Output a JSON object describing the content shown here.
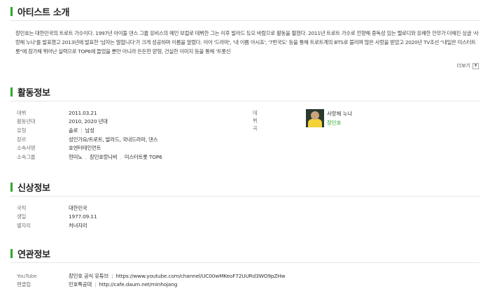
{
  "intro": {
    "heading": "아티스트 소개",
    "text": "장민호는 대한민국의 트로트 가수이다. 1997년 아이돌 댄스 그룹 유비스의 메인 보컬로 데뷔한 그는 이후 발라드 듀오 바람으로 활동을 펼쳤다. 2011년 트로트 가수로 전향해 중독성 있는 멜로디와 유쾌한 안무가 더해진 싱글 '사랑해 누나'를 발표했고 2013년에 발표한 '남자는 말합니다'가 크게 성공하며 이름을 알렸다. 이어 '드라마', '내 이름 아시죠', '7번국도' 등을 통해 트로트계의 BTS로 불리며 많은 사랑을 받았고 2020년 TV조선 \"내일은 미스터트롯\"에 참가해 뛰어난 실력으로 TOP6에 들었을 뿐만 아니라 든든한 맏형, 건실한 이미지 등을 통해 '트롯신",
    "more_label": "더보기"
  },
  "activity": {
    "heading": "활동정보",
    "rows": [
      {
        "key": "데뷔",
        "value": "2011.03.21"
      },
      {
        "key": "활동년대",
        "value": "2010, 2020 년대"
      },
      {
        "key": "유형",
        "values": [
          "솔로",
          "남성"
        ]
      },
      {
        "key": "장르",
        "value": "성인가요/트로트, 발라드, 국내드라마, 댄스"
      },
      {
        "key": "소속사명",
        "value": "호엔터테인먼트"
      },
      {
        "key": "소속그룹",
        "values": [
          "현미노",
          "장민호랑나비",
          "미스터트롯 TOP6"
        ]
      }
    ],
    "debut_song": {
      "key": "데뷔곡",
      "title": "사랑해 누나",
      "artist": "장민호"
    }
  },
  "profile": {
    "heading": "신상정보",
    "rows": [
      {
        "key": "국적",
        "value": "대한민국"
      },
      {
        "key": "생일",
        "value": "1977.09.11"
      },
      {
        "key": "별자리",
        "value": "처녀자리"
      }
    ]
  },
  "related": {
    "heading": "연관정보",
    "rows": [
      {
        "key": "YouTube",
        "name": "장민호 공식 유튜브",
        "url": "https://www.youtube.com/channel/UC00wMKeoF72UURd3WO9pZHw"
      },
      {
        "key": "팬클럽",
        "name": "민호특공대",
        "url": "http://cafe.daum.net/minhojang"
      }
    ]
  },
  "colors": {
    "accent": "#2ea82e",
    "rule": "#e6e6e6"
  }
}
